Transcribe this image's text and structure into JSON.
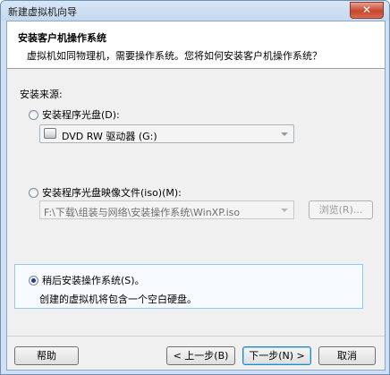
{
  "window": {
    "title": "新建虚拟机向导",
    "close_symbol": "✕"
  },
  "header": {
    "title": "安装客户机操作系统",
    "description": "虚拟机如同物理机，需要操作系统。您将如何安装客户机操作系统？"
  },
  "source": {
    "label": "安装来源:",
    "option_disc": {
      "label": "安装程序光盘(D):",
      "selected": false
    },
    "drive_select": {
      "value": "DVD RW 驱动器 (G:)",
      "icon": "dvd-drive-icon"
    },
    "option_iso": {
      "label": "安装程序光盘映像文件(iso)(M):",
      "selected": false
    },
    "iso_path": {
      "value": "F:\\下载\\组装与网络\\安装操作系统\\WinXP.iso"
    },
    "browse_button": "浏览(R)...",
    "option_later": {
      "label": "稍后安装操作系统(S)。",
      "selected": true
    },
    "later_hint": "创建的虚拟机将包含一个空白硬盘。"
  },
  "footer": {
    "help": "帮助",
    "back": "< 上一步(B)",
    "next": "下一步(N) >",
    "cancel": "取消"
  }
}
